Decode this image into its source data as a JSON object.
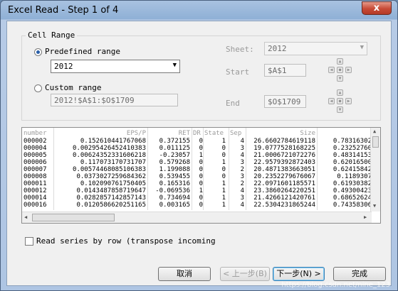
{
  "window": {
    "title": "Excel Read - Step 1 of 4",
    "close_glyph": "x"
  },
  "cell_range": {
    "group_label": "Cell Range",
    "predefined_label": "Predefined range",
    "predefined_value": "2012",
    "custom_label": "Custom range",
    "custom_value": "2012!$A$1:$O$1709",
    "sheet_label": "Sheet:",
    "sheet_value": "2012",
    "start_label": "Start",
    "start_value": "$A$1",
    "end_label": "End",
    "end_value": "$O$1709",
    "nav_glyphs": {
      "up": "▲",
      "down": "▼",
      "left": "◀",
      "right": "▶",
      "dot": "●"
    }
  },
  "preview": {
    "headers": [
      "number",
      "EPS/P",
      "RET",
      "DR",
      "State",
      "Sep",
      "",
      "Size",
      ""
    ],
    "rows": [
      [
        "000002",
        "0.152610441767068",
        "0.372155",
        "0",
        "1",
        "4",
        "26.6602784619118",
        "0.78316302"
      ],
      [
        "000004",
        "0.00295426452410383",
        "0.011125",
        "0",
        "0",
        "3",
        "19.0777528168225",
        "0.23252760"
      ],
      [
        "000005",
        "0.00624352331606218",
        "-0.23057",
        "1",
        "0",
        "4",
        "21.0006721072276",
        "0.48314153"
      ],
      [
        "000006",
        "0.117073170731707",
        "0.579268",
        "0",
        "1",
        "3",
        "22.9579392872403",
        "0.62016500"
      ],
      [
        "000007",
        "0.00574468085106383",
        "1.199088",
        "0",
        "0",
        "2",
        "20.4871383663051",
        "0.62415842"
      ],
      [
        "000008",
        "0.0373027259684362",
        "0.539455",
        "0",
        "0",
        "3",
        "20.2352279676067",
        "0.1189307"
      ],
      [
        "000011",
        "0.102090761750405",
        "0.165316",
        "0",
        "1",
        "2",
        "22.0971601185571",
        "0.61930382"
      ],
      [
        "000012",
        "0.0143487858719647",
        "-0.069536",
        "1",
        "1",
        "4",
        "23.3860264220251",
        "0.49300423"
      ],
      [
        "000014",
        "0.0282857142857143",
        "0.734694",
        "0",
        "1",
        "3",
        "21.4266121420761",
        "0.68652624"
      ],
      [
        "000016",
        "0.0120586620251165",
        "0.003165",
        "0",
        "1",
        "4",
        "22.5304231865244",
        "0.74358306"
      ]
    ]
  },
  "options": {
    "transpose_label": "Read series by row (transpose incoming"
  },
  "buttons": {
    "cancel": "取消",
    "back": "< 上一步(B)",
    "next": "下一步(N) >",
    "finish": "完成"
  },
  "watermark": "https://blog.csdn.net/nine_123"
}
